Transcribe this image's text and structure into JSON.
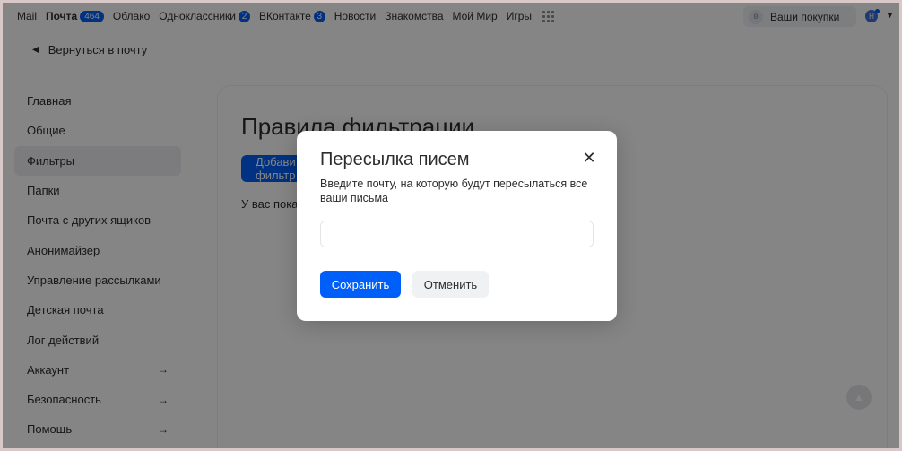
{
  "portal": {
    "links": [
      {
        "label": "Mail"
      },
      {
        "label": "Почта",
        "badge": "464"
      },
      {
        "label": "Облако"
      },
      {
        "label": "Одноклассники",
        "badge": "2"
      },
      {
        "label": "ВКонтакте",
        "badge": "3"
      },
      {
        "label": "Новости"
      },
      {
        "label": "Знакомства"
      },
      {
        "label": "Мой Мир"
      },
      {
        "label": "Игры"
      }
    ],
    "purchases_label": "Ваши покупки",
    "avatar_initial": "Н"
  },
  "back_label": "Вернуться в почту",
  "sidebar": {
    "items": [
      {
        "label": "Главная"
      },
      {
        "label": "Общие"
      },
      {
        "label": "Фильтры",
        "active": true
      },
      {
        "label": "Папки"
      },
      {
        "label": "Почта с других ящиков"
      },
      {
        "label": "Анонимайзер"
      },
      {
        "label": "Управление рассылками"
      },
      {
        "label": "Детская почта"
      },
      {
        "label": "Лог действий"
      },
      {
        "label": "Аккаунт",
        "arrow": "→"
      },
      {
        "label": "Безопасность",
        "arrow": "→"
      },
      {
        "label": "Помощь",
        "arrow": "→"
      }
    ]
  },
  "content": {
    "title": "Правила фильтрации",
    "add_button_label": "Добавить фильтр",
    "empty_text": "У вас пока нет фильтров"
  },
  "modal": {
    "title": "Пересылка писем",
    "close_icon": "close-icon",
    "description": "Введите почту, на которую будут пересылаться все ваши письма",
    "email_value": "",
    "email_placeholder": "",
    "save_label": "Сохранить",
    "cancel_label": "Отменить"
  },
  "colors": {
    "accent": "#005ff9",
    "overlay": "rgba(0,0,0,0.48)"
  }
}
